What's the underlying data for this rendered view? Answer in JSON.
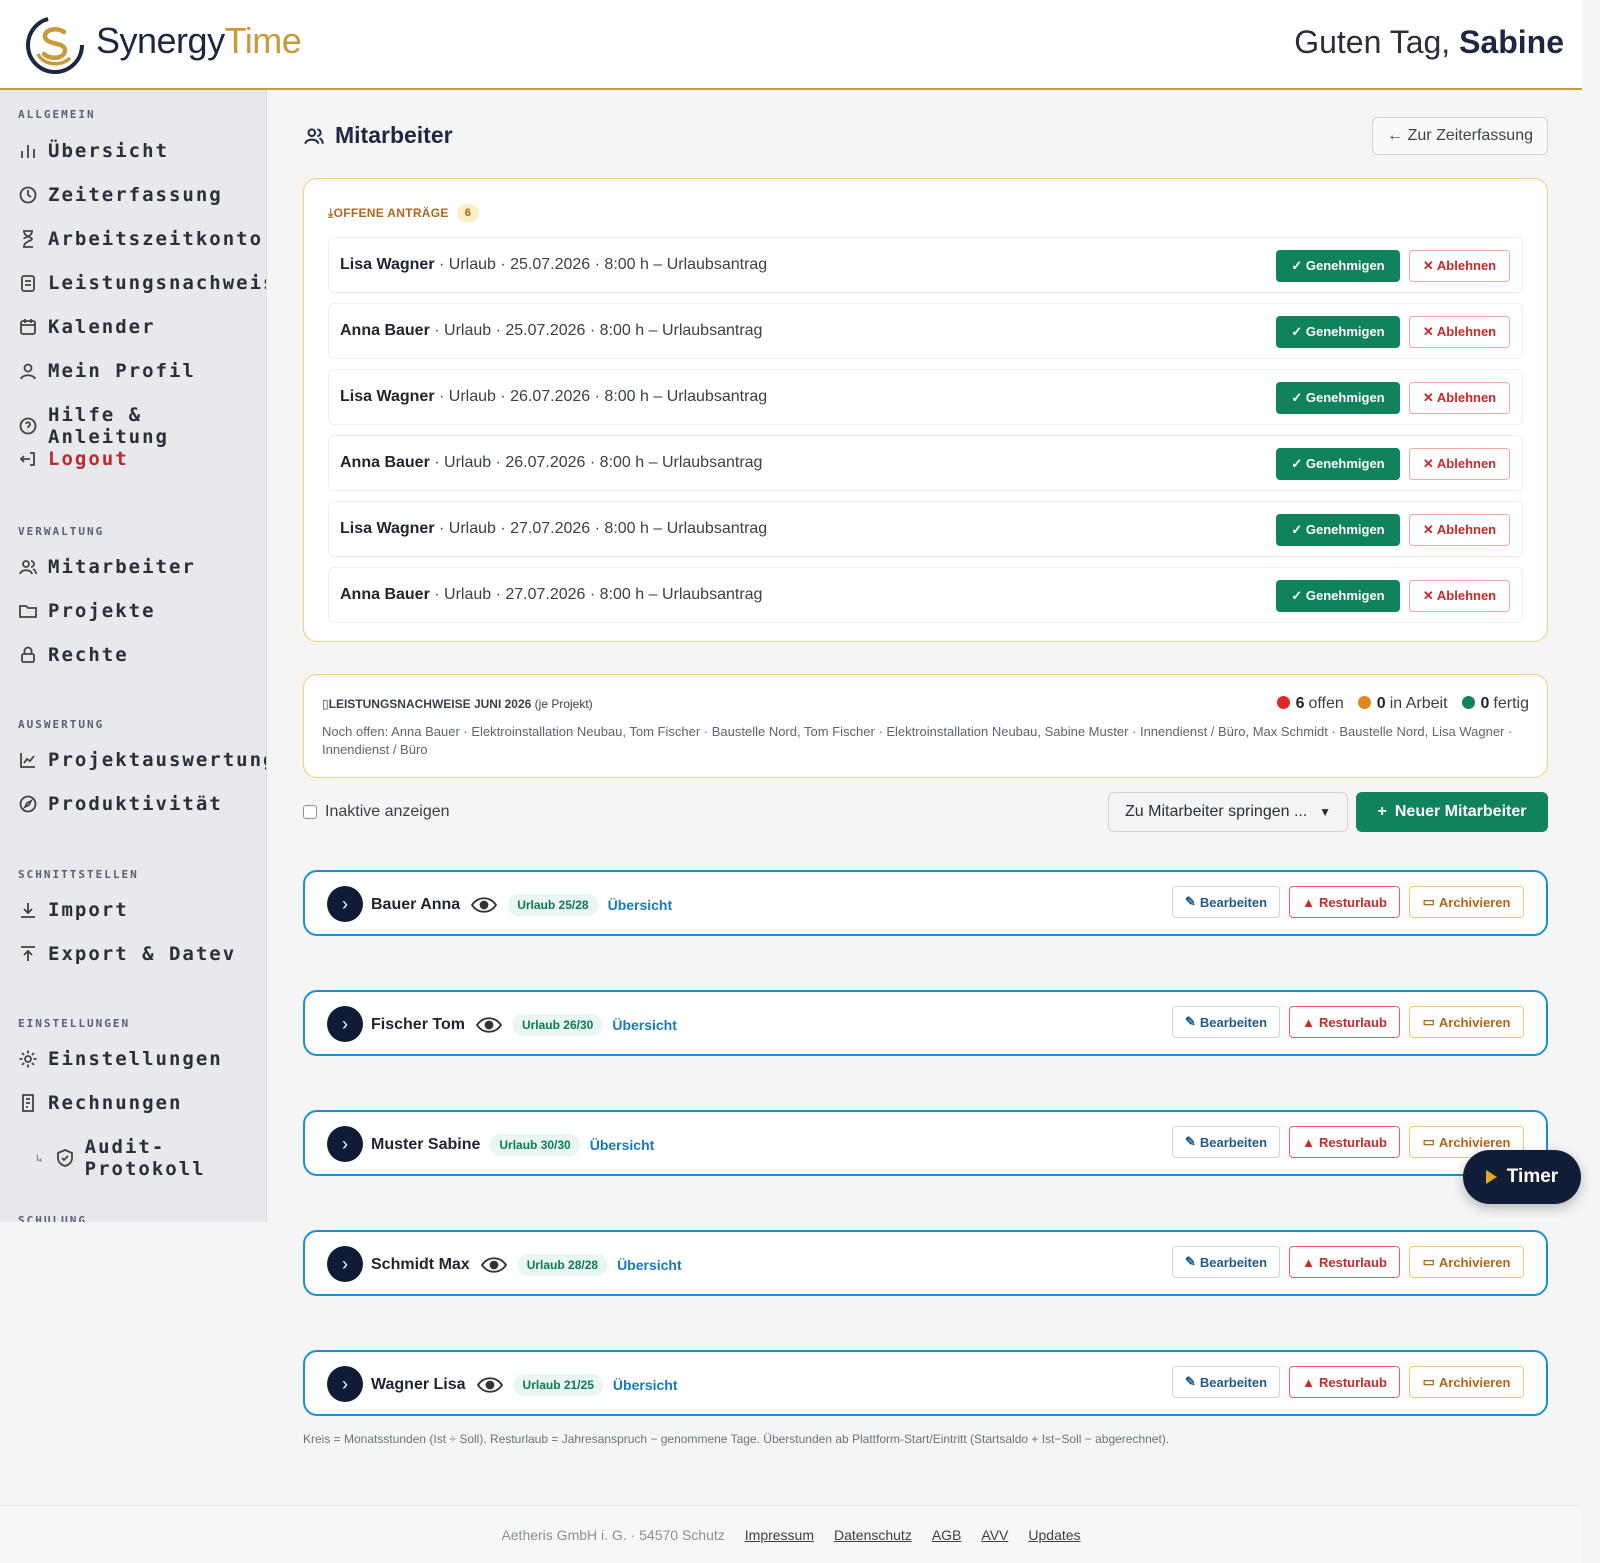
{
  "brand": {
    "name_a": "Synergy",
    "name_b": "Time",
    "greeting_prefix": "Guten Tag,",
    "user": "Sabine",
    "colors": {
      "navy": "#1d2742",
      "gold": "#c99a3b",
      "green": "#11835c",
      "red": "#c62b2b",
      "blue": "#1a8fd6"
    }
  },
  "sidebar": {
    "sections": [
      {
        "label": "ALLGEMEIN"
      },
      {
        "label": "VERWALTUNG"
      },
      {
        "label": "AUSWERTUNG"
      },
      {
        "label": "SCHNITTSTELLEN"
      },
      {
        "label": "EINSTELLUNGEN"
      },
      {
        "label": "SCHULUNG"
      }
    ],
    "items": [
      {
        "label": "Übersicht",
        "icon": "bar-chart-icon"
      },
      {
        "label": "Zeiterfassung",
        "icon": "clock-icon"
      },
      {
        "label": "Arbeitszeitkonto",
        "icon": "hourglass-icon"
      },
      {
        "label": "Leistungsnachweis",
        "icon": "clipboard-icon"
      },
      {
        "label": "Kalender",
        "icon": "calendar-icon"
      },
      {
        "label": "Mein Profil",
        "icon": "user-icon"
      },
      {
        "label": "Hilfe & Anleitung",
        "icon": "help-icon"
      },
      {
        "label": "Logout",
        "icon": "logout-icon"
      },
      {
        "label": "Mitarbeiter",
        "icon": "users-icon"
      },
      {
        "label": "Projekte",
        "icon": "folder-icon"
      },
      {
        "label": "Rechte",
        "icon": "lock-icon"
      },
      {
        "label": "Projektauswertung",
        "icon": "line-chart-icon"
      },
      {
        "label": "Produktivität",
        "icon": "compass-icon"
      },
      {
        "label": "Import",
        "icon": "download-icon"
      },
      {
        "label": "Export & Datev",
        "icon": "upload-icon"
      },
      {
        "label": "Einstellungen",
        "icon": "gear-icon"
      },
      {
        "label": "Rechnungen",
        "icon": "invoice-icon"
      },
      {
        "label": "Audit-Protokoll",
        "icon": "shield-icon"
      }
    ]
  },
  "page": {
    "title": "Mitarbeiter",
    "back_button": "← Zur Zeiterfassung"
  },
  "requests": {
    "heading": "OFFENE ANTRÄGE",
    "count": "6",
    "approve_label": "✓ Genehmigen",
    "reject_label": "✕ Ablehnen",
    "items": [
      {
        "name": "Lisa Wagner",
        "detail": " · Urlaub · 25.07.2026 · 8:00 h – Urlaubsantrag"
      },
      {
        "name": "Anna Bauer",
        "detail": " · Urlaub · 25.07.2026 · 8:00 h – Urlaubsantrag"
      },
      {
        "name": "Lisa Wagner",
        "detail": " · Urlaub · 26.07.2026 · 8:00 h – Urlaubsantrag"
      },
      {
        "name": "Anna Bauer",
        "detail": " · Urlaub · 26.07.2026 · 8:00 h – Urlaubsantrag"
      },
      {
        "name": "Lisa Wagner",
        "detail": " · Urlaub · 27.07.2026 · 8:00 h – Urlaubsantrag"
      },
      {
        "name": "Anna Bauer",
        "detail": " · Urlaub · 27.07.2026 · 8:00 h – Urlaubsantrag"
      }
    ]
  },
  "leistung": {
    "heading": "LEISTUNGSNACHWEISE JUNI 2026",
    "heading_suffix": " (je Projekt)",
    "offen_count": "6",
    "offen_label": "offen",
    "arbeit_count": "0",
    "arbeit_label": "in Arbeit",
    "fertig_count": "0",
    "fertig_label": "fertig",
    "body": "Noch offen: Anna Bauer · Elektroinstallation Neubau, Tom Fischer · Baustelle Nord, Tom Fischer · Elektroinstallation Neubau, Sabine Muster · Innendienst / Büro, Max Schmidt · Baustelle Nord, Lisa Wagner · Innendienst / Büro"
  },
  "filters": {
    "inactive_label": "Inaktive anzeigen",
    "jump_select": "Zu Mitarbeiter springen ...",
    "new_button": "Neuer Mitarbeiter"
  },
  "employees": {
    "edit_label": "Bearbeiten",
    "rest_label": "Resturlaub",
    "archive_label": "Archivieren",
    "overview_label": "Übersicht",
    "items": [
      {
        "name": "Bauer Anna",
        "urlaub": "Urlaub 25/28",
        "eye": true
      },
      {
        "name": "Fischer Tom",
        "urlaub": "Urlaub 26/30",
        "eye": true
      },
      {
        "name": "Muster Sabine",
        "urlaub": "Urlaub 30/30",
        "eye": false
      },
      {
        "name": "Schmidt Max",
        "urlaub": "Urlaub 28/28",
        "eye": true
      },
      {
        "name": "Wagner Lisa",
        "urlaub": "Urlaub 21/25",
        "eye": true
      }
    ]
  },
  "note": "Kreis = Monatsstunden (Ist ÷ Soll). Resturlaub = Jahresanspruch − genommene Tage. Überstunden ab Plattform-Start/Eintritt (Startsaldo + Ist−Soll − abgerechnet).",
  "footer": {
    "company": "Aetheris GmbH i. G. · 54570 Schutz",
    "links": [
      "Impressum",
      "Datenschutz",
      "AGB",
      "AVV",
      "Updates"
    ]
  },
  "timer": {
    "label": "Timer"
  }
}
